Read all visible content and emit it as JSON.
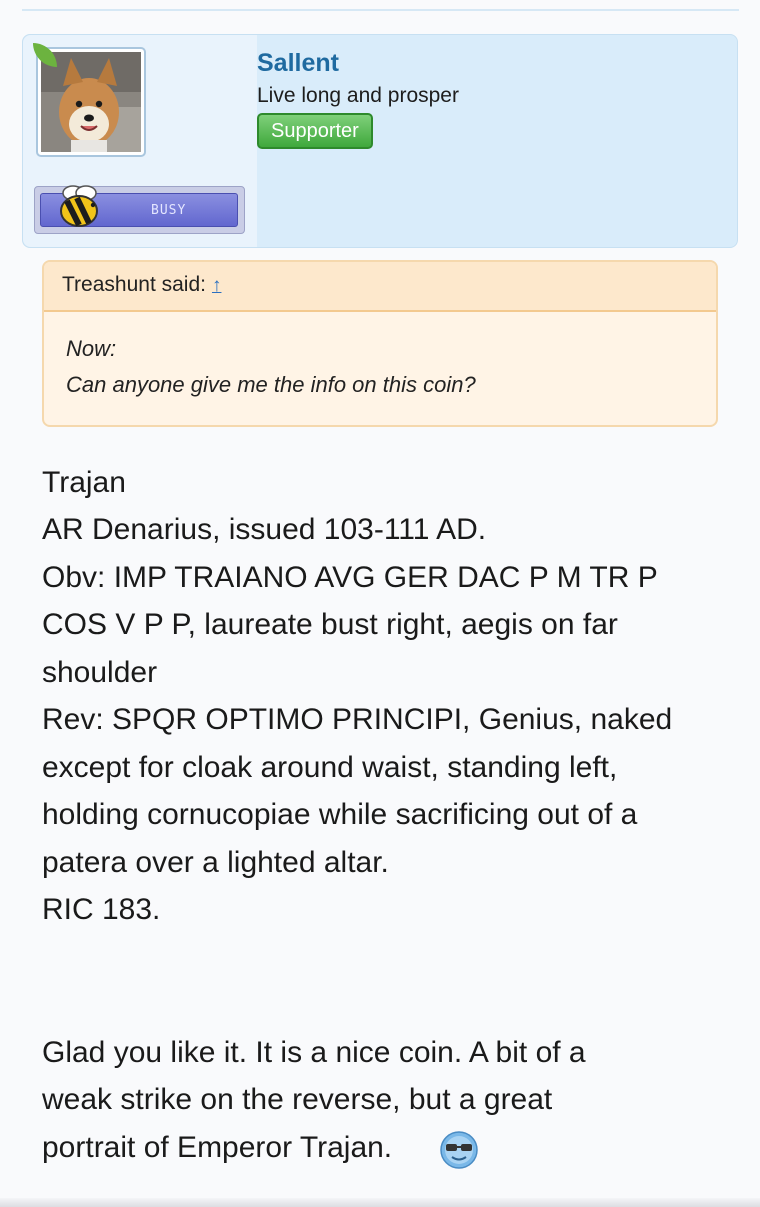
{
  "user": {
    "name": "Sallent",
    "title": "Live long and prosper",
    "banner": "Supporter",
    "status_badge": "BUSY"
  },
  "quote": {
    "author_text": "Treashunt said:",
    "jump_link": "↑",
    "lines": [
      "Now:",
      "Can anyone give me the info on this coin?"
    ]
  },
  "post": {
    "lines": [
      "Trajan",
      "AR Denarius, issued 103-111 AD.",
      "Obv: IMP TRAIANO AVG GER DAC P M TR P",
      "COS V P P, laureate bust right, aegis on far",
      "shoulder",
      "Rev: SPQR OPTIMO PRINCIPI, Genius, naked",
      "except for cloak around waist, standing left,",
      "holding cornucopiae while sacrificing out of a",
      "patera over a lighted altar.",
      "RIC 183.",
      "Glad you like it. It is a nice coin. A bit of a",
      "weak strike on the reverse, but a great",
      "portrait of Emperor Trajan."
    ],
    "emoji": "cool-sunglasses-emoji"
  },
  "colors": {
    "username": "#1f6aa0",
    "user_block_bg": "#d9ecfa",
    "banner_green": "#3fa83c",
    "quote_bg": "#fff4e6",
    "link": "#2a6fc0"
  }
}
